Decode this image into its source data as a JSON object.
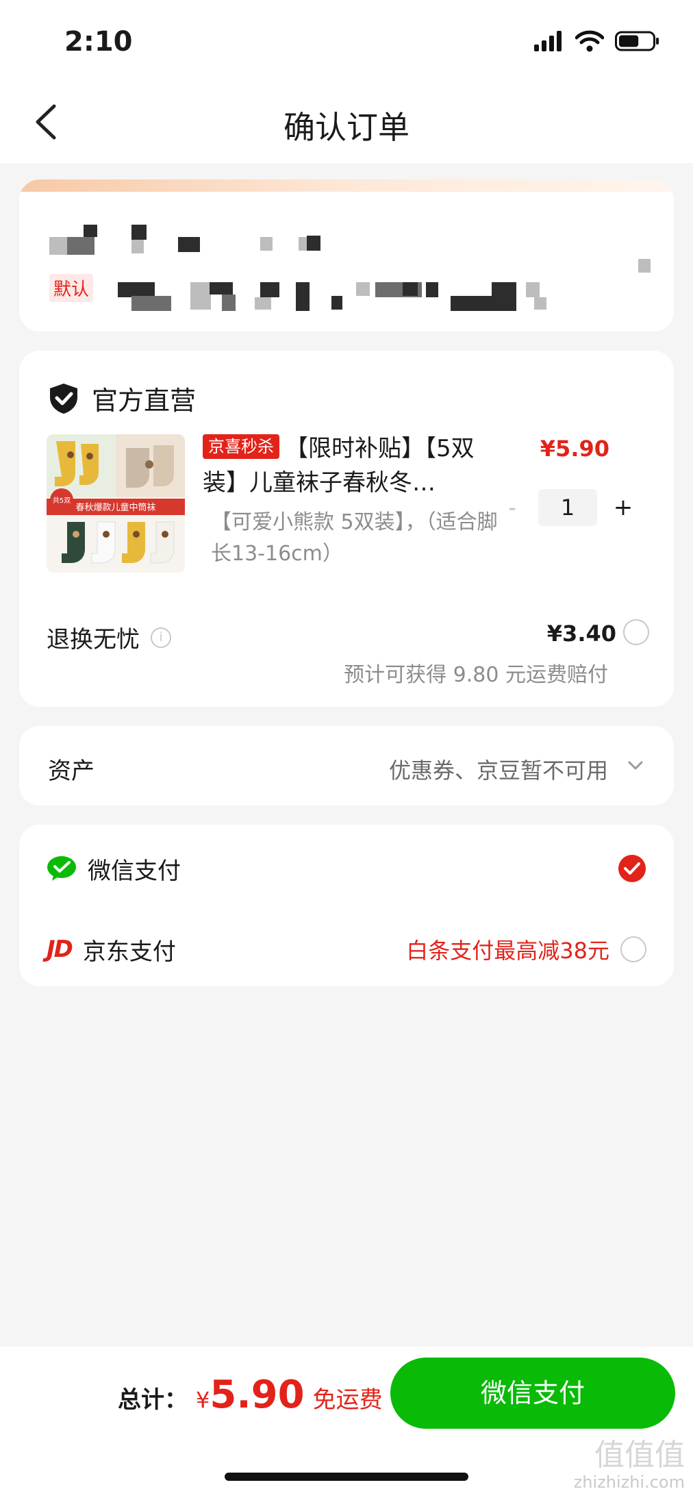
{
  "status_bar": {
    "time": "2:10",
    "battery_level": 0.6
  },
  "nav": {
    "title": "确认订单"
  },
  "address": {
    "default_tag": "默认"
  },
  "order": {
    "shop_name": "官方直营",
    "product": {
      "tag": "京喜秒杀",
      "title": "【限时补贴】【5双装】儿童袜子春秋冬…",
      "price": "¥5.90",
      "spec": "【可爱小熊款 5双装】，（适合脚长13-16cm）",
      "image_text_1": "共5双",
      "image_text_2": "春秋爆款儿童中筒袜",
      "quantity": "1",
      "minus": "-",
      "plus": "+"
    },
    "service": {
      "label": "退换无忧",
      "price": "¥3.40",
      "note": "预计可获得 9.80 元运费赔付"
    }
  },
  "assets": {
    "label": "资产",
    "value": "优惠券、京豆暂不可用"
  },
  "payment": {
    "wechat": {
      "label": "微信支付",
      "selected": true
    },
    "jd": {
      "logo": "JD",
      "label": "京东支付",
      "promo": "白条支付最高减38元",
      "selected": false
    }
  },
  "footer": {
    "total_label": "总计：",
    "currency": "¥",
    "amount": "5.90",
    "shipping": "免运费",
    "pay_button": "微信支付"
  },
  "watermark": {
    "line1": "值值值",
    "line2": "zhizhizhi.com"
  },
  "colors": {
    "accent_red": "#e2231a",
    "wechat_green": "#09bb07"
  }
}
